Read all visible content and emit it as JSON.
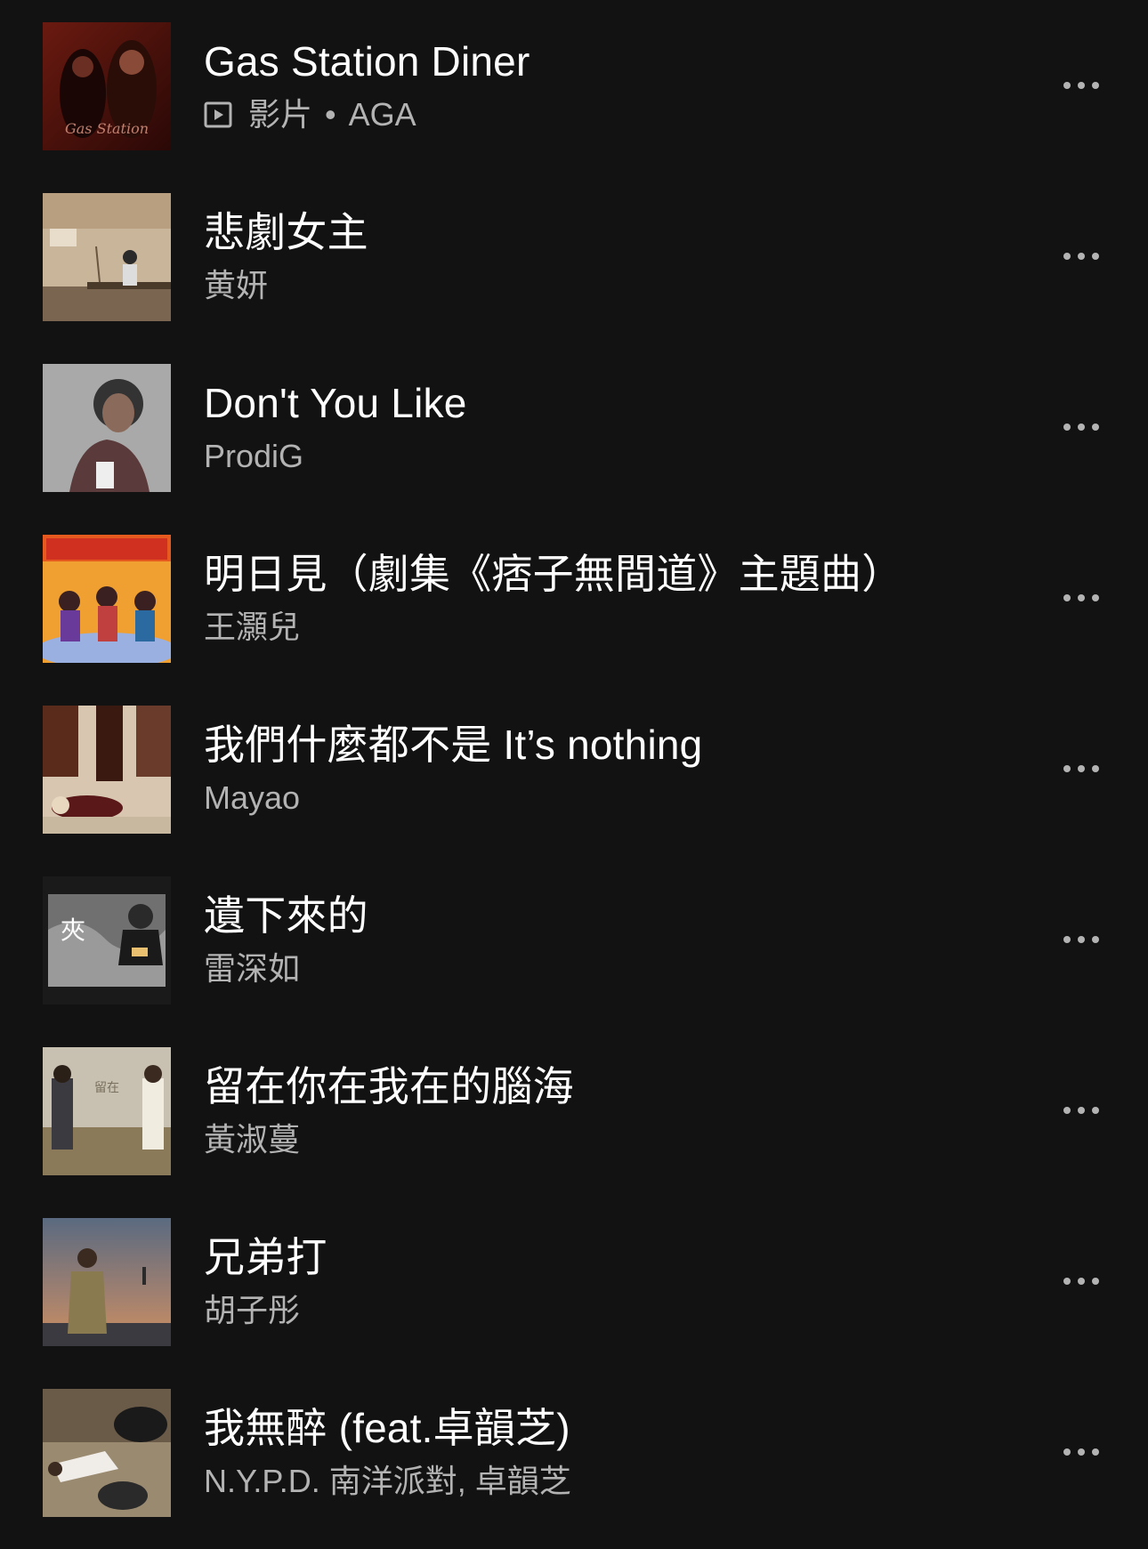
{
  "tracks": [
    {
      "title": "Gas Station Diner",
      "type_label": "影片",
      "separator": "•",
      "artist": "AGA",
      "is_video": true
    },
    {
      "title": "悲劇女主",
      "artist": "黄妍"
    },
    {
      "title": "Don't You Like",
      "artist": "ProdiG"
    },
    {
      "title": "明日見（劇集《痞子無間道》主題曲）",
      "artist": "王灝兒"
    },
    {
      "title": "我們什麼都不是 It’s nothing",
      "artist": "Mayao"
    },
    {
      "title": "遺下來的",
      "artist": "雷深如"
    },
    {
      "title": "留在你在我在的腦海",
      "artist": "黃淑蔓"
    },
    {
      "title": "兄弟打",
      "artist": "胡子彤"
    },
    {
      "title": "我無醉 (feat.卓韻芝)",
      "artist": "N.Y.P.D. 南洋派對, 卓韻芝"
    }
  ],
  "icons": {
    "more": "more-options-icon",
    "video": "video-icon"
  },
  "colors": {
    "background": "#121212",
    "title": "#ffffff",
    "subtitle": "#b3b3b3"
  }
}
